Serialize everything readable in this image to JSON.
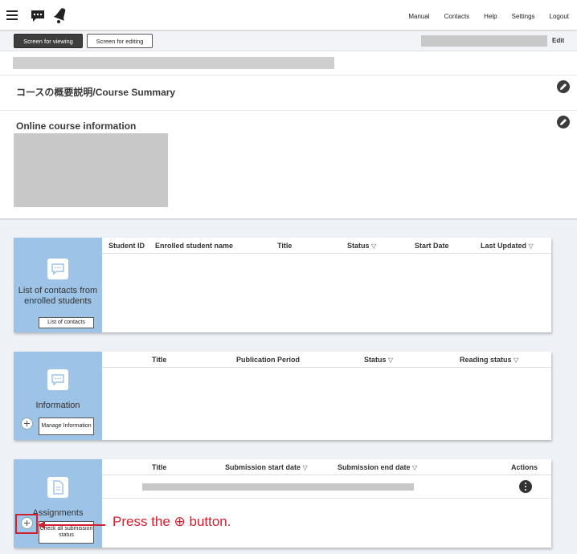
{
  "nav": {
    "manual": "Manual",
    "contacts": "Contacts",
    "help": "Help",
    "settings": "Settings",
    "logout": "Logout"
  },
  "mode": {
    "viewing": "Screen for viewing",
    "editing": "Screen for editing",
    "edit": "Edit"
  },
  "sections": {
    "course_summary": "コースの概要説明/Course Summary",
    "online_info": "Online course information"
  },
  "contacts_panel": {
    "label": "List of contacts from enrolled students",
    "button": "List of contacts",
    "columns": [
      "Student ID",
      "Enrolled student name",
      "Title",
      "Status",
      "Start Date",
      "Last Updated"
    ],
    "sort_marker": "▽"
  },
  "information_panel": {
    "label": "Information",
    "button": "Manage Information",
    "columns": [
      "Title",
      "Publication Period",
      "Status",
      "Reading status"
    ],
    "sort_marker": "▽"
  },
  "assignments_panel": {
    "label": "Assignments",
    "button": "Check all submission status",
    "columns": [
      "Title",
      "Submission start date",
      "Submission end date",
      "Actions"
    ],
    "sort_marker": "▽"
  },
  "annotation": {
    "text": "Press the ⊕ button.",
    "color": "#d2202f"
  },
  "colors": {
    "panel_side": "#9dc3e6",
    "view_button": "#3e3e3e"
  }
}
